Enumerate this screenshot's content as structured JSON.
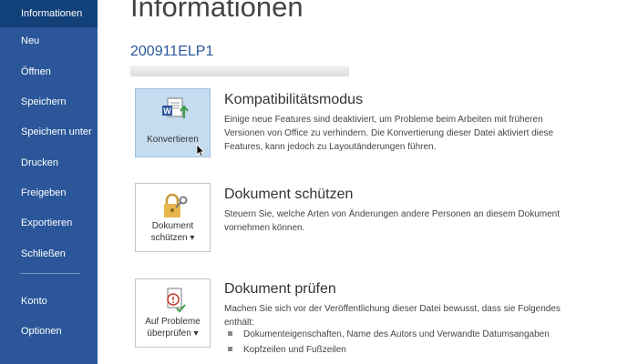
{
  "sidebar": {
    "items": [
      {
        "label": "Informationen",
        "active": true
      },
      {
        "label": "Neu"
      },
      {
        "label": "Öffnen"
      },
      {
        "label": "Speichern"
      },
      {
        "label": "Speichern unter"
      },
      {
        "label": "Drucken"
      },
      {
        "label": "Freigeben"
      },
      {
        "label": "Exportieren"
      },
      {
        "label": "Schließen"
      },
      {
        "label": "Konto"
      },
      {
        "label": "Optionen"
      }
    ]
  },
  "main": {
    "title": "Informationen",
    "document_name": "200911ELP1",
    "sections": [
      {
        "button_label": "Konvertieren",
        "title": "Kompatibilitätsmodus",
        "description": "Einige neue Features sind deaktiviert, um Probleme beim Arbeiten mit früheren Versionen von Office zu verhindern. Die Konvertierung dieser Datei aktiviert diese Features, kann jedoch zu Layoutänderungen führen.",
        "icon": "word-convert-icon"
      },
      {
        "button_label_line1": "Dokument",
        "button_label_line2": "schützen ▾",
        "title": "Dokument schützen",
        "description": "Steuern Sie, welche Arten von Änderungen andere Personen an diesem Dokument vornehmen können.",
        "icon": "lock-key-icon"
      },
      {
        "button_label_line1": "Auf Probleme",
        "button_label_line2": "überprüfen ▾",
        "title": "Dokument prüfen",
        "description": "Machen Sie sich vor der Veröffentlichung dieser Datei bewusst, dass sie Folgendes enthält:",
        "bullets": [
          "Dokumenteigenschaften, Name des Autors und Verwandte Datumsangaben",
          "Kopfzeilen und Fußzeilen"
        ],
        "icon": "inspect-document-icon"
      }
    ]
  },
  "colors": {
    "sidebar_bg": "#2b579a",
    "sidebar_active": "#124078",
    "accent": "#2b579a",
    "selected_button": "#c5dbef"
  }
}
